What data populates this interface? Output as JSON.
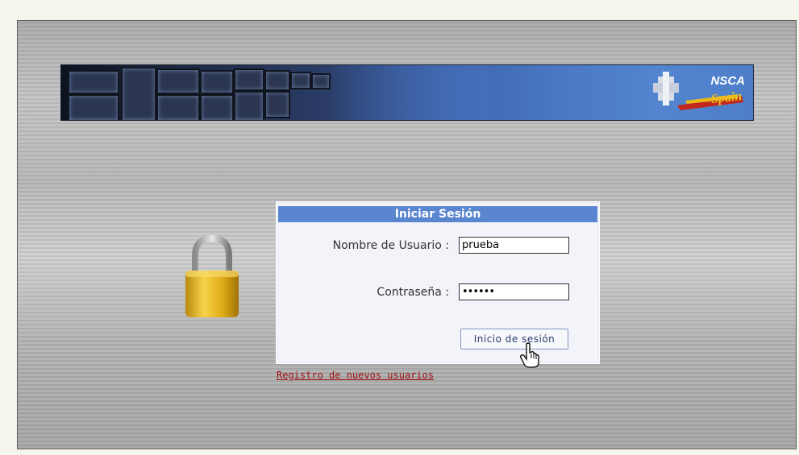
{
  "banner": {
    "logo_text": "NSCA",
    "logo_subtext": "Spain"
  },
  "login": {
    "title": "Iniciar Sesión",
    "username_label": "Nombre de Usuario :",
    "username_value": "prueba",
    "password_label": "Contraseña :",
    "password_value": "••••••",
    "submit_label": "Inicio de sesión"
  },
  "register_link": "Registro de nuevos usuarios",
  "icons": {
    "padlock": "padlock-icon",
    "cursor": "hand-pointer-icon"
  }
}
